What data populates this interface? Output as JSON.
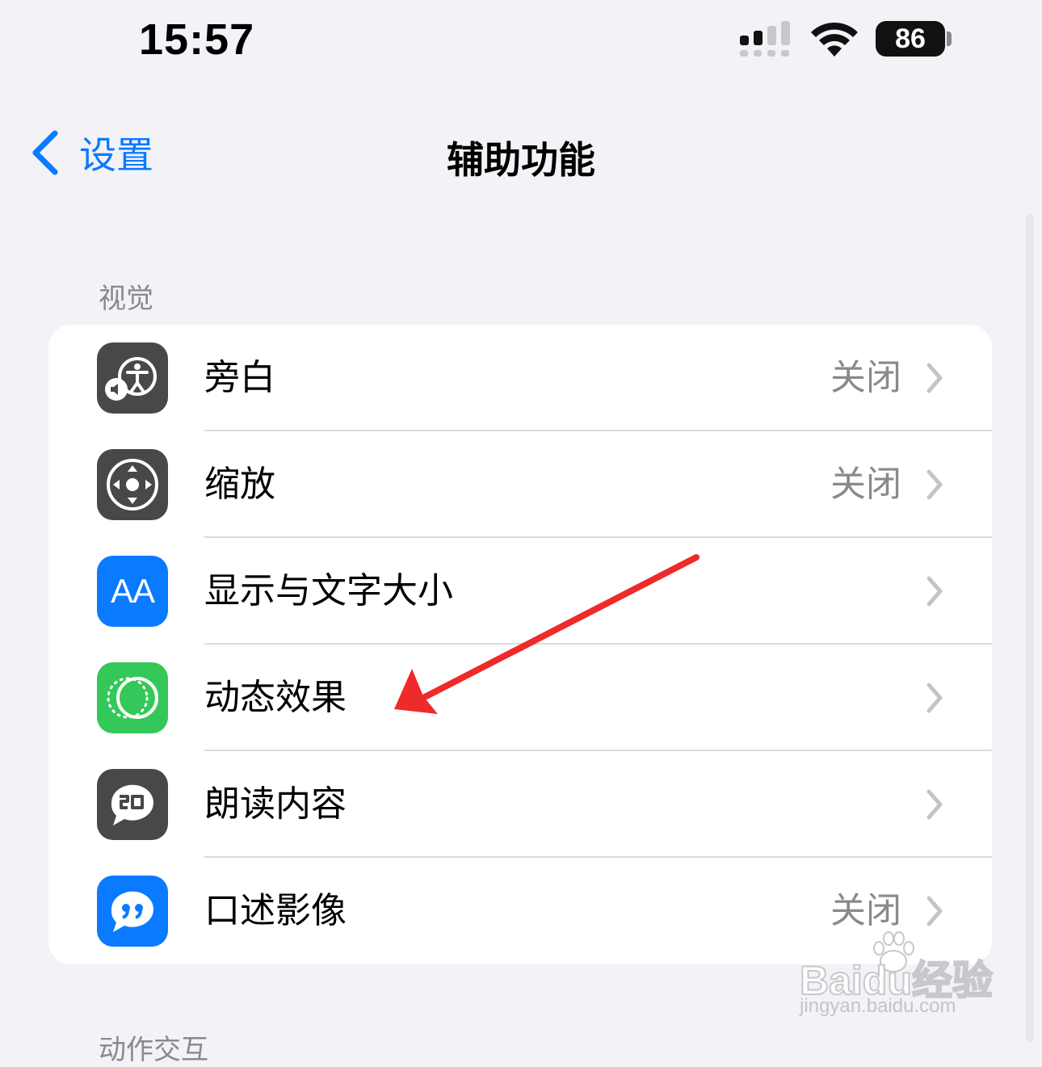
{
  "status_bar": {
    "time": "15:57",
    "battery": "86"
  },
  "nav": {
    "back_label": "设置",
    "title": "辅助功能"
  },
  "section": {
    "header": "视觉",
    "next_header": "动作交互"
  },
  "rows": [
    {
      "label": "旁白",
      "value": "关闭",
      "icon": "voiceover-icon",
      "icon_color": "#48484a"
    },
    {
      "label": "缩放",
      "value": "关闭",
      "icon": "zoom-icon",
      "icon_color": "#48484a"
    },
    {
      "label": "显示与文字大小",
      "value": "",
      "icon": "text-size-icon",
      "icon_color": "#0a7aff",
      "icon_text": "AA"
    },
    {
      "label": "动态效果",
      "value": "",
      "icon": "motion-icon",
      "icon_color": "#34c759"
    },
    {
      "label": "朗读内容",
      "value": "",
      "icon": "spoken-content-icon",
      "icon_color": "#48484a"
    },
    {
      "label": "口述影像",
      "value": "关闭",
      "icon": "audio-descriptions-icon",
      "icon_color": "#0a7aff"
    }
  ],
  "watermark": {
    "brand": "Baidu经验",
    "url": "jingyan.baidu.com"
  },
  "colors": {
    "accent": "#0a7aff",
    "background": "#f2f2f7",
    "annotation": "#ee2a2a"
  }
}
